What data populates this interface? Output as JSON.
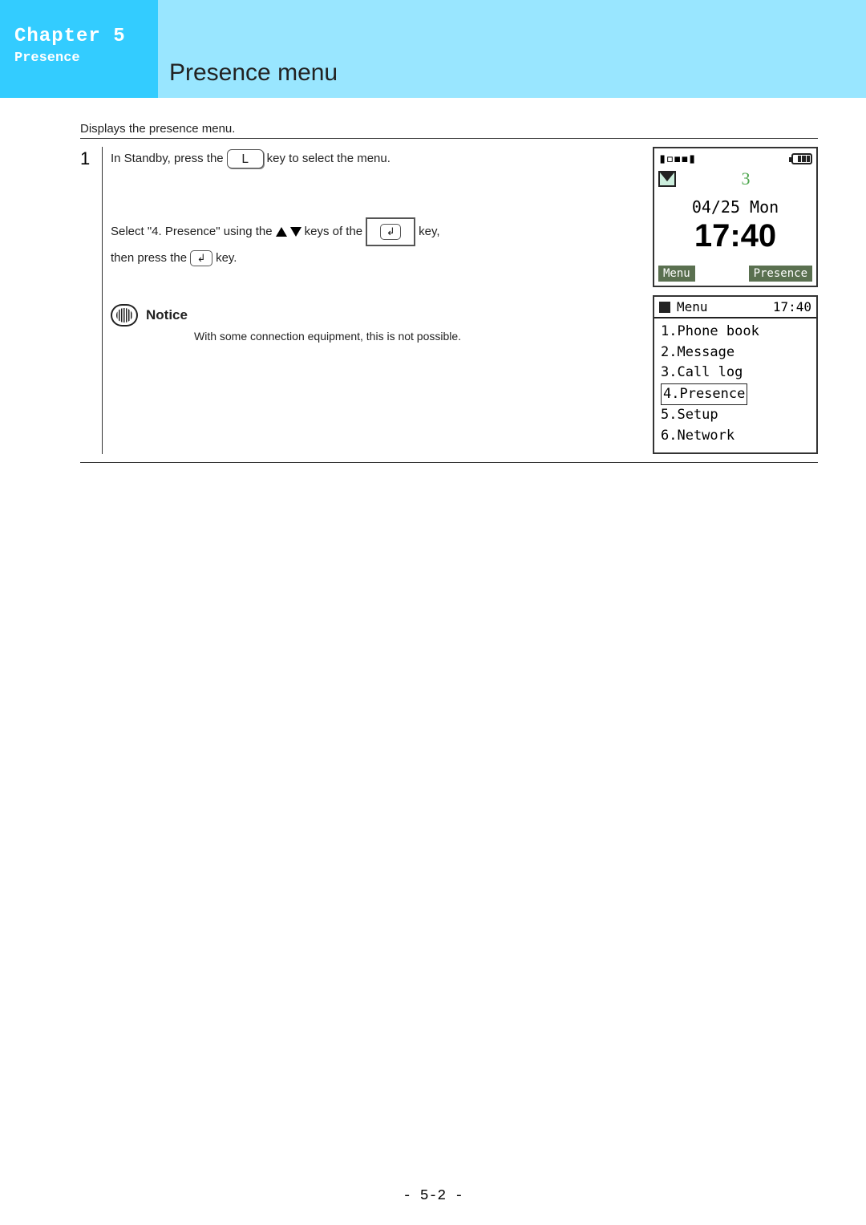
{
  "chapter": {
    "title": "Chapter 5",
    "subtitle": "Presence"
  },
  "page_title": "Presence menu",
  "intro": "Displays the presence menu.",
  "step": {
    "num": "1",
    "line1_a": "In Standby, press the",
    "line1_key": "L",
    "line1_b": "key to select the menu.",
    "line2_a": "Select \"4. Presence\" using the",
    "line2_b": "keys of the",
    "line2_c": "key,",
    "line3_a": "then press the",
    "line3_b": "key."
  },
  "notice": {
    "label": "Notice",
    "text": "With some connection equipment, this is not possible."
  },
  "screen1": {
    "num": "3",
    "date": "04/25 Mon",
    "time": "17:40",
    "sk_left": "Menu",
    "sk_right": "Presence"
  },
  "screen2": {
    "title": "Menu",
    "clock": "17:40",
    "items": [
      "1.Phone book",
      "2.Message",
      "3.Call log",
      "4.Presence",
      "5.Setup",
      "6.Network"
    ],
    "selected_index": 3
  },
  "footer": "- 5-2 -"
}
